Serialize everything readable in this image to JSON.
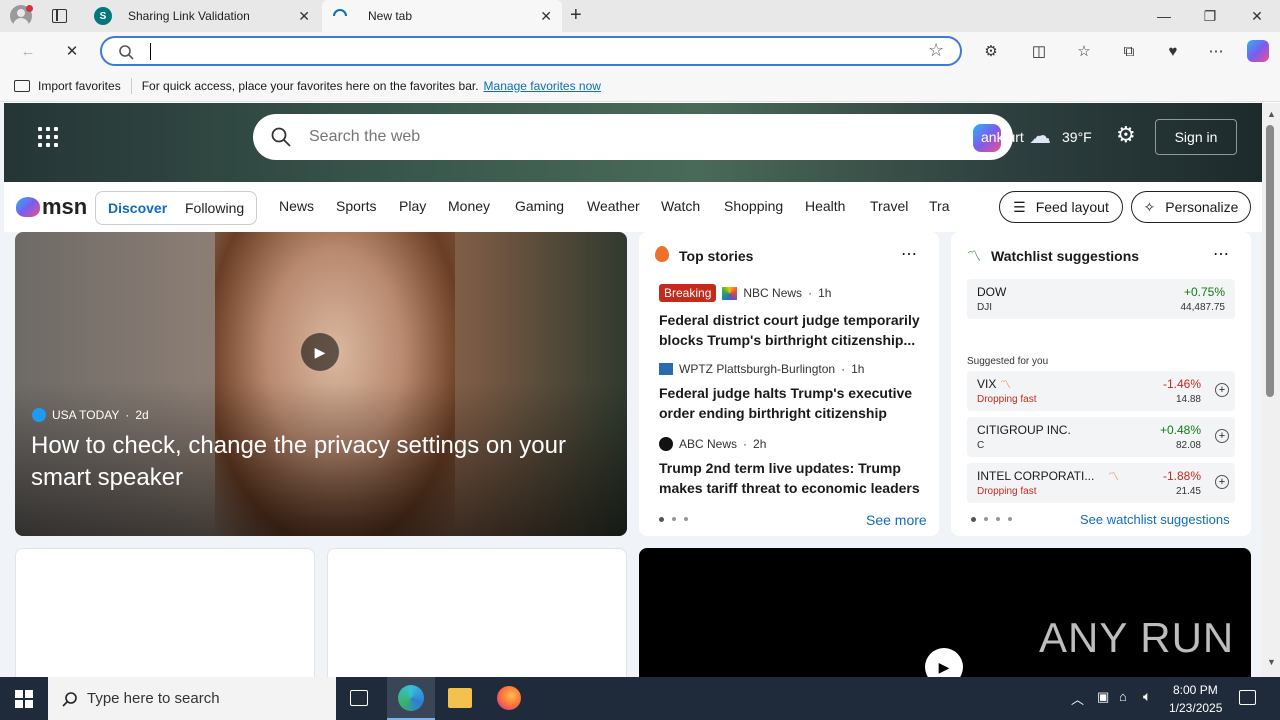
{
  "tabs": [
    {
      "title": "Sharing Link Validation"
    },
    {
      "title": "New tab"
    }
  ],
  "favorites_bar": {
    "import_label": "Import favorites",
    "hint": "For quick access, place your favorites here on the favorites bar.",
    "manage_link": "Manage favorites now"
  },
  "msn": {
    "search_placeholder": "Search the web",
    "location_partial": "ankfurt",
    "temperature": "39°F",
    "sign_in": "Sign in",
    "logo_text": "msn",
    "feed_tabs": [
      "Discover",
      "Following"
    ],
    "nav": [
      "News",
      "Sports",
      "Play",
      "Money",
      "Gaming",
      "Weather",
      "Watch",
      "Shopping",
      "Health",
      "Travel",
      "Tra"
    ],
    "feed_layout": "Feed layout",
    "personalize": "Personalize"
  },
  "hero": {
    "source": "USA TODAY",
    "age": "2d",
    "headline": "How to check, change the privacy settings on your smart speaker"
  },
  "top_stories": {
    "title": "Top stories",
    "items": [
      {
        "badge": "Breaking",
        "source": "NBC News",
        "age": "1h",
        "headline": "Federal district court judge temporarily blocks Trump's birthright citizenship..."
      },
      {
        "badge": "",
        "source": "WPTZ Plattsburgh-Burlington",
        "age": "1h",
        "headline": "Federal judge halts Trump's executive order ending birthright citizenship"
      },
      {
        "badge": "",
        "source": "ABC News",
        "age": "2h",
        "headline": "Trump 2nd term live updates: Trump makes tariff threat to economic leaders"
      }
    ],
    "see_more": "See more"
  },
  "watchlist": {
    "title": "Watchlist suggestions",
    "top": {
      "name": "DOW",
      "sub": "DJI",
      "change": "+0.75%",
      "price": "44,487.75"
    },
    "suggested_label": "Suggested for you",
    "items": [
      {
        "name": "VIX",
        "sub": "Dropping fast",
        "change": "-1.46%",
        "price": "14.88"
      },
      {
        "name": "CITIGROUP INC.",
        "sub": "C",
        "change": "+0.48%",
        "price": "82.08"
      },
      {
        "name": "INTEL CORPORATI...",
        "sub": "Dropping fast",
        "change": "-1.88%",
        "price": "21.45"
      }
    ],
    "see_all": "See watchlist suggestions"
  },
  "watermark": "ANY RUN",
  "taskbar": {
    "search_placeholder": "Type here to search",
    "time": "8:00 PM",
    "date": "1/23/2025"
  },
  "colors": {
    "accent": "#0f6cbd",
    "positive": "#107c10",
    "negative": "#c42b1c",
    "breaking": "#c42b1c"
  }
}
